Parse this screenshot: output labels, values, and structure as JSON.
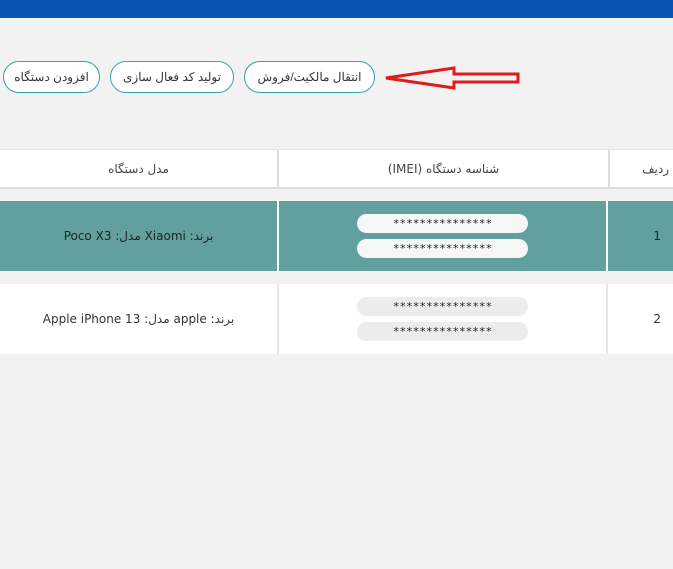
{
  "actions": {
    "transfer_label": "انتقال مالکیت/فروش",
    "generate_code_label": "تولید کد فعال سازی",
    "add_device_label": "افزودن دستگاه"
  },
  "table": {
    "headers": {
      "row": "ردیف",
      "imei": "شناسه دستگاه (IMEI)",
      "model": "مدل دستگاه"
    },
    "rows": [
      {
        "index": "1",
        "imei1": "***************",
        "imei2": "***************",
        "model": "برند: Xiaomi مدل: Poco X3"
      },
      {
        "index": "2",
        "imei1": "***************",
        "imei2": "***************",
        "model": "برند: apple مدل: Apple iPhone 13"
      }
    ]
  },
  "colors": {
    "topbar": "#0a55b0",
    "accent": "#3aa0ad",
    "selected_row": "#62a0a0",
    "annotation_arrow": "#e01b1b"
  }
}
